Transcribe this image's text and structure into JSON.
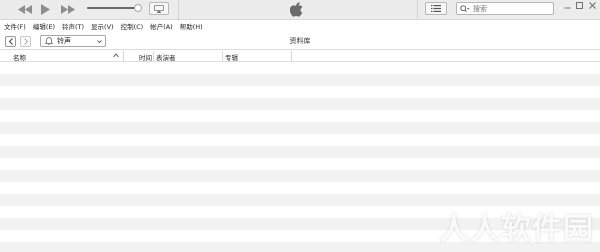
{
  "toolbar": {
    "volume_level": 1.0,
    "search_placeholder": "搜索"
  },
  "menu": {
    "items": [
      "文件(F)",
      "编辑(E)",
      "铃声(T)",
      "显示(V)",
      "控制(C)",
      "帐户(A)",
      "帮助(H)"
    ]
  },
  "nav": {
    "media_selector": "铃声",
    "library_title": "资料库"
  },
  "columns": {
    "name": "名称",
    "time": "时间",
    "artist": "表演者",
    "album": "专辑"
  },
  "watermark": {
    "text": "人人软件园"
  },
  "colors": {
    "toolbar_bg": "#ececec",
    "row_alt": "#f2f2f2",
    "icon_gray": "#8e8e8e"
  },
  "icons": {
    "previous": "rewind-icon",
    "play": "play-icon",
    "next": "fast-forward-icon",
    "airplay": "airplay-icon",
    "logo": "apple-logo-icon",
    "list": "list-view-icon",
    "search": "search-icon",
    "back": "chevron-left-icon",
    "forward": "chevron-right-icon",
    "media": "bell-icon",
    "sort": "sort-up-icon"
  }
}
